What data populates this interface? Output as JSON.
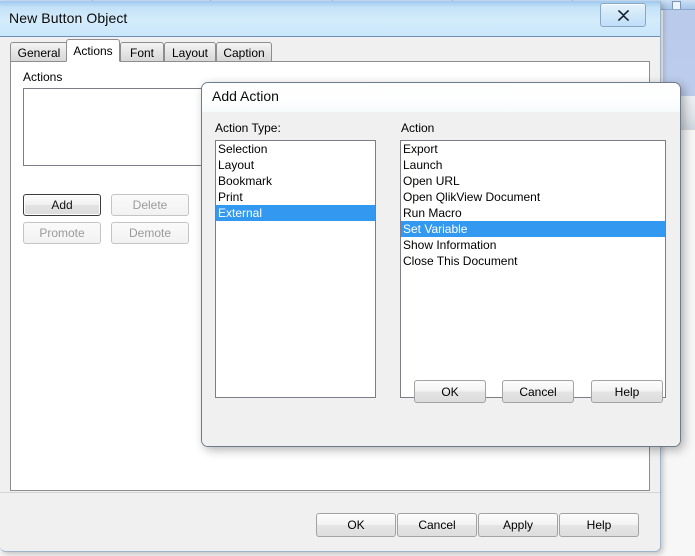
{
  "colors": {
    "selection_blue": "#3399f0",
    "selection_text": "#ffffff",
    "title_bar_blue": "#c9e6fa",
    "dialog_face": "#f0f0f0",
    "disabled_text": "#9a9a9a"
  },
  "main_window": {
    "title": "New Button Object",
    "close_icon": "close-icon",
    "tabs": [
      {
        "label": "General",
        "active": false
      },
      {
        "label": "Actions",
        "active": true
      },
      {
        "label": "Font",
        "active": false
      },
      {
        "label": "Layout",
        "active": false
      },
      {
        "label": "Caption",
        "active": false
      }
    ],
    "actions_group": {
      "label": "Actions",
      "list_items": [],
      "buttons": [
        {
          "label": "Add",
          "enabled": true,
          "focused": true
        },
        {
          "label": "Delete",
          "enabled": false,
          "focused": false
        },
        {
          "label": "Promote",
          "enabled": false,
          "focused": false
        },
        {
          "label": "Demote",
          "enabled": false,
          "focused": false
        }
      ]
    },
    "footer_buttons": [
      {
        "label": "OK"
      },
      {
        "label": "Cancel"
      },
      {
        "label": "Apply"
      },
      {
        "label": "Help"
      }
    ]
  },
  "add_action_dialog": {
    "title": "Add Action",
    "action_type": {
      "label": "Action Type:",
      "items": [
        "Selection",
        "Layout",
        "Bookmark",
        "Print",
        "External"
      ],
      "selected": "External"
    },
    "action": {
      "label": "Action",
      "items": [
        "Export",
        "Launch",
        "Open URL",
        "Open QlikView Document",
        "Run Macro",
        "Set Variable",
        "Show Information",
        "Close This Document"
      ],
      "selected": "Set Variable"
    },
    "buttons": [
      {
        "label": "OK"
      },
      {
        "label": "Cancel"
      },
      {
        "label": "Help"
      }
    ]
  }
}
